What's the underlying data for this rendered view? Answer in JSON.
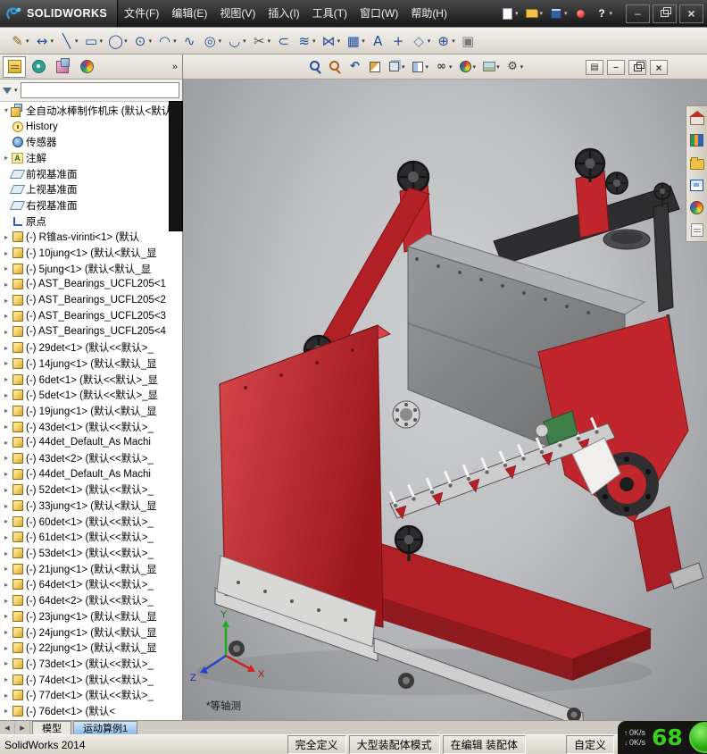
{
  "titlebar": {
    "app_name": "SOLIDWORKS",
    "menus": [
      "文件(F)",
      "编辑(E)",
      "视图(V)",
      "插入(I)",
      "工具(T)",
      "窗口(W)",
      "帮助(H)"
    ],
    "quick_access": [
      {
        "name": "new-document",
        "dd": true
      },
      {
        "name": "open",
        "dd": true
      },
      {
        "name": "save",
        "dd": true
      },
      {
        "name": "rebuild",
        "dd": false
      },
      {
        "name": "help",
        "glyph": "?",
        "dd": true
      }
    ]
  },
  "main_toolbar": [
    {
      "name": "sketch",
      "glyph": "✎",
      "color": "#8a6d1f",
      "dd": true
    },
    {
      "name": "smart-dimension",
      "glyph": "↔",
      "color": "#1f4e9b",
      "dd": true
    },
    {
      "name": "line",
      "glyph": "╲",
      "color": "#1f4e9b",
      "dd": true
    },
    {
      "name": "corner-rectangle",
      "glyph": "▭",
      "color": "#1f4e9b",
      "dd": true
    },
    {
      "name": "circle",
      "glyph": "◯",
      "color": "#1f4e9b",
      "dd": true
    },
    {
      "name": "perimeter-circle",
      "glyph": "⊙",
      "color": "#1f4e9b",
      "dd": true
    },
    {
      "name": "centerpoint-arc",
      "glyph": "◠",
      "color": "#1f4e9b",
      "dd": true
    },
    {
      "name": "spline",
      "glyph": "∿",
      "color": "#1f4e9b",
      "dd": false
    },
    {
      "name": "ellipse",
      "glyph": "◎",
      "color": "#1f4e9b",
      "dd": true
    },
    {
      "name": "sketch-fillet",
      "glyph": "◡",
      "color": "#1f4e9b",
      "dd": true
    },
    {
      "name": "trim-entities",
      "glyph": "✂",
      "color": "#555555",
      "dd": true
    },
    {
      "name": "convert-entities",
      "glyph": "⊂",
      "color": "#1f4e9b",
      "dd": false
    },
    {
      "name": "offset-entities",
      "glyph": "≋",
      "color": "#1f4e9b",
      "dd": true
    },
    {
      "name": "mirror-entities",
      "glyph": "⋈",
      "color": "#1f4e9b",
      "dd": true
    },
    {
      "name": "linear-sketch-pattern",
      "glyph": "▦",
      "color": "#1f4e9b",
      "dd": true
    },
    {
      "name": "text",
      "glyph": "A",
      "color": "#1f4e9b",
      "dd": false
    },
    {
      "name": "point",
      "glyph": "+",
      "color": "#1f4e9b",
      "dd": false
    },
    {
      "name": "plane",
      "glyph": "◇",
      "color": "#5b7fa6",
      "dd": true
    },
    {
      "name": "quick-snaps",
      "glyph": "⊕",
      "color": "#1f4e9b",
      "dd": true
    },
    {
      "name": "sketch-picture",
      "glyph": "▣",
      "color": "#777777",
      "dd": false
    }
  ],
  "headsup": [
    {
      "name": "zoom-to-fit"
    },
    {
      "name": "zoom-to-area"
    },
    {
      "name": "previous-view",
      "glyph": "↶"
    },
    {
      "name": "section-view"
    },
    {
      "name": "view-orientation",
      "dd": true
    },
    {
      "name": "display-style",
      "dd": true
    },
    {
      "name": "hide-show-items",
      "glyph": "∞",
      "dd": true
    },
    {
      "name": "edit-appearance",
      "dd": true
    },
    {
      "name": "apply-scene",
      "dd": true
    },
    {
      "name": "view-settings",
      "glyph": "⚙",
      "dd": true
    }
  ],
  "taskpane": [
    {
      "name": "solidworks-resources"
    },
    {
      "name": "design-library"
    },
    {
      "name": "file-explorer"
    },
    {
      "name": "view-palette"
    },
    {
      "name": "appearances-scenes"
    },
    {
      "name": "custom-properties"
    }
  ],
  "panel": {
    "tabs": [
      {
        "name": "featuremanager",
        "active": true
      },
      {
        "name": "propertymanager",
        "active": false
      },
      {
        "name": "configurationmanager",
        "active": false
      },
      {
        "name": "displaymanager",
        "active": false
      }
    ],
    "overflow": "»",
    "filter_value": "",
    "tree": [
      {
        "icon": "assembly",
        "arrow": "▾",
        "label": "全自动冰棒制作机床 (默认<默认"
      },
      {
        "icon": "history",
        "arrow": "",
        "label": "History"
      },
      {
        "icon": "sensors",
        "arrow": "",
        "label": "传感器"
      },
      {
        "icon": "annotations",
        "arrow": "▸",
        "label": "注解"
      },
      {
        "icon": "plane",
        "arrow": "",
        "label": "前视基准面"
      },
      {
        "icon": "plane",
        "arrow": "",
        "label": "上视基准面"
      },
      {
        "icon": "plane",
        "arrow": "",
        "label": "右视基准面"
      },
      {
        "icon": "origin",
        "arrow": "",
        "label": "原点"
      },
      {
        "icon": "part",
        "arrow": "▸",
        "label": "(-) R锥as-virinti<1> (默认"
      },
      {
        "icon": "part",
        "arrow": "▸",
        "label": "(-) 10jung<1> (默认<默认_显"
      },
      {
        "icon": "part",
        "arrow": "▸",
        "label": "(-) 5jung<1> (默认<默认_显"
      },
      {
        "icon": "part",
        "arrow": "▸",
        "label": "(-) AST_Bearings_UCFL205<1"
      },
      {
        "icon": "part",
        "arrow": "▸",
        "label": "(-) AST_Bearings_UCFL205<2"
      },
      {
        "icon": "part",
        "arrow": "▸",
        "label": "(-) AST_Bearings_UCFL205<3"
      },
      {
        "icon": "part",
        "arrow": "▸",
        "label": "(-) AST_Bearings_UCFL205<4"
      },
      {
        "icon": "part",
        "arrow": "▸",
        "label": "(-) 29det<1> (默认<<默认>_"
      },
      {
        "icon": "part",
        "arrow": "▸",
        "label": "(-) 14jung<1> (默认<默认_显"
      },
      {
        "icon": "part",
        "arrow": "▸",
        "label": "(-) 6det<1> (默认<<默认>_显"
      },
      {
        "icon": "part",
        "arrow": "▸",
        "label": "(-) 5det<1> (默认<<默认>_显"
      },
      {
        "icon": "part",
        "arrow": "▸",
        "label": "(-) 19jung<1> (默认<默认_显"
      },
      {
        "icon": "part",
        "arrow": "▸",
        "label": "(-) 43det<1> (默认<<默认>_"
      },
      {
        "icon": "part",
        "arrow": "▸",
        "label": "(-) 44det_Default_As Machi"
      },
      {
        "icon": "part",
        "arrow": "▸",
        "label": "(-) 43det<2> (默认<<默认>_"
      },
      {
        "icon": "part",
        "arrow": "▸",
        "label": "(-) 44det_Default_As Machi"
      },
      {
        "icon": "part",
        "arrow": "▸",
        "label": "(-) 52det<1> (默认<<默认>_"
      },
      {
        "icon": "part",
        "arrow": "▸",
        "label": "(-) 33jung<1> (默认<默认_显"
      },
      {
        "icon": "part",
        "arrow": "▸",
        "label": "(-) 60det<1> (默认<<默认>_"
      },
      {
        "icon": "part",
        "arrow": "▸",
        "label": "(-) 61det<1> (默认<<默认>_"
      },
      {
        "icon": "part",
        "arrow": "▸",
        "label": "(-) 53det<1> (默认<<默认>_"
      },
      {
        "icon": "part",
        "arrow": "▸",
        "label": "(-) 21jung<1> (默认<默认_显"
      },
      {
        "icon": "part",
        "arrow": "▸",
        "label": "(-) 64det<1> (默认<<默认>_"
      },
      {
        "icon": "part",
        "arrow": "▸",
        "label": "(-) 64det<2> (默认<<默认>_"
      },
      {
        "icon": "part",
        "arrow": "▸",
        "label": "(-) 23jung<1> (默认<默认_显"
      },
      {
        "icon": "part",
        "arrow": "▸",
        "label": "(-) 24jung<1> (默认<默认_显"
      },
      {
        "icon": "part",
        "arrow": "▸",
        "label": "(-) 22jung<1> (默认<默认_显"
      },
      {
        "icon": "part",
        "arrow": "▸",
        "label": "(-) 73det<1> (默认<<默认>_"
      },
      {
        "icon": "part",
        "arrow": "▸",
        "label": "(-) 74det<1> (默认<<默认>_"
      },
      {
        "icon": "part",
        "arrow": "▸",
        "label": "(-) 77det<1> (默认<<默认>_"
      },
      {
        "icon": "part",
        "arrow": "▸",
        "label": "(-) 76det<1> (默认<"
      }
    ]
  },
  "viewport": {
    "view_label": "*等轴测",
    "triad": {
      "x": "X",
      "y": "Y",
      "z": "Z"
    }
  },
  "doc_tabs": {
    "tabs": [
      {
        "label": "模型",
        "active": true
      },
      {
        "label": "运动算例1",
        "active": false
      }
    ]
  },
  "statusbar": {
    "app_version": "SolidWorks 2014",
    "segments": [
      "完全定义",
      "大型装配体模式",
      "在编辑 装配体",
      "自定义"
    ]
  },
  "overlay": {
    "upload": "0K/s",
    "download": "0K/s",
    "value": "68"
  },
  "colors": {
    "machine_red": "#c0272d",
    "tank_gray": "#87898b",
    "overlay_green": "#37d11d"
  }
}
